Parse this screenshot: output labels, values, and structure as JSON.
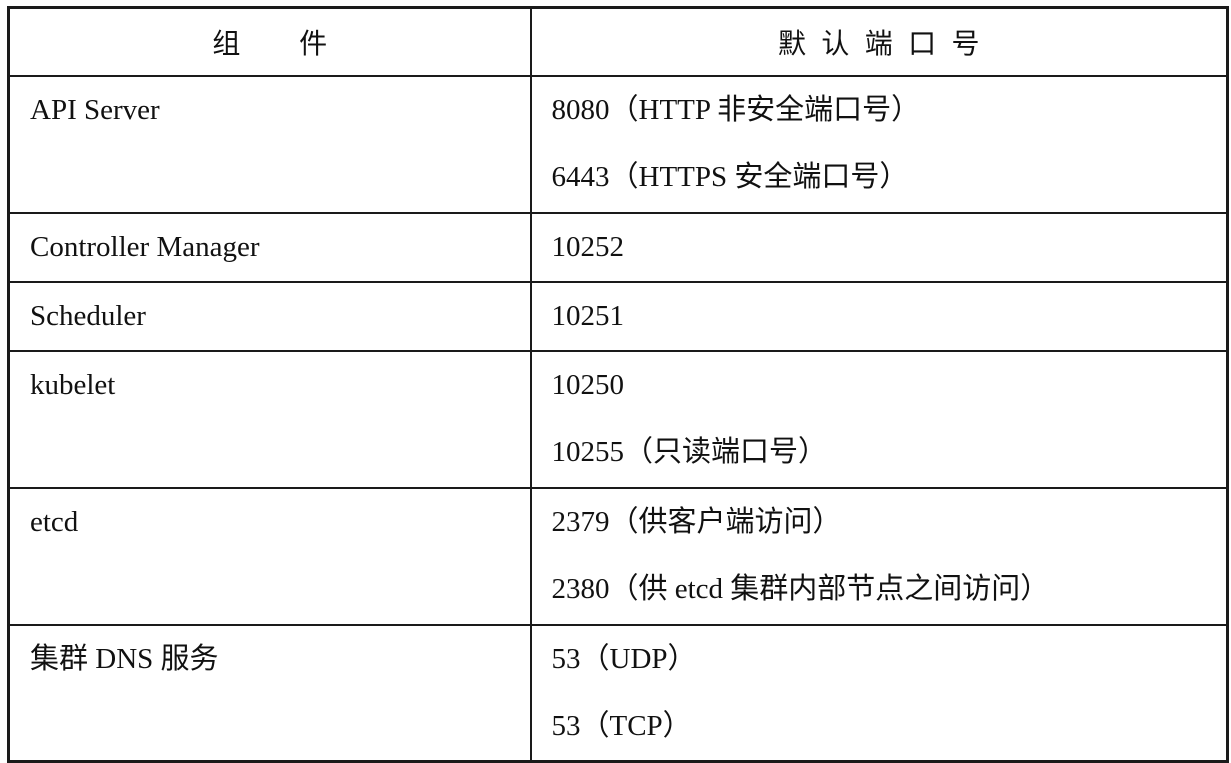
{
  "table": {
    "headers": [
      "组　件",
      "默认端口号"
    ],
    "rows": [
      {
        "component": "API Server",
        "ports": [
          "8080（HTTP 非安全端口号）",
          "6443（HTTPS 安全端口号）"
        ]
      },
      {
        "component": "Controller Manager",
        "ports": [
          "10252"
        ]
      },
      {
        "component": "Scheduler",
        "ports": [
          "10251"
        ]
      },
      {
        "component": "kubelet",
        "ports": [
          "10250",
          "10255（只读端口号）"
        ]
      },
      {
        "component": "etcd",
        "ports": [
          "2379（供客户端访问）",
          "2380（供 etcd 集群内部节点之间访问）"
        ]
      },
      {
        "component": "集群 DNS 服务",
        "ports": [
          "53（UDP）",
          "53（TCP）"
        ]
      }
    ]
  }
}
